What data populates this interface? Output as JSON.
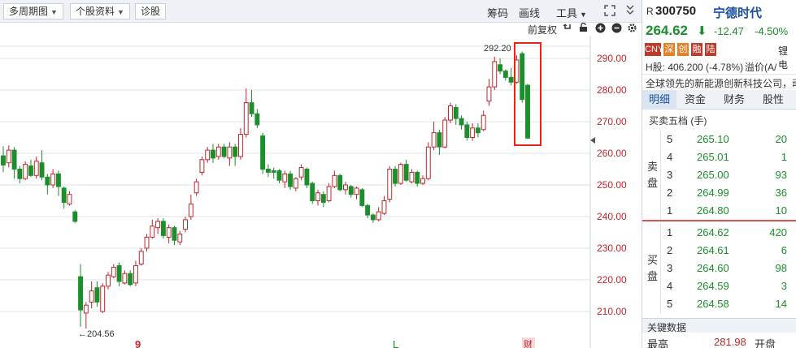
{
  "toolbar": {
    "period_label": "多周期图",
    "stock_info_label": "个股资料",
    "diagnose_label": "诊股",
    "chips_label": "筹码",
    "draw_label": "画线",
    "tools_label": "工具",
    "expand_icon": "expand-icon",
    "collapse_icon": "collapse-icon"
  },
  "subbar": {
    "adjust_label": "前复权",
    "icons": [
      "undo-icon",
      "lock-icon",
      "zoom-in-icon",
      "zoom-out-icon",
      "settings-icon"
    ]
  },
  "chart_data": {
    "type": "candlestick",
    "y_ticks": [
      "290.00",
      "280.00",
      "270.00",
      "260.00",
      "250.00",
      "240.00",
      "230.00",
      "220.00",
      "210.00"
    ],
    "ylim": [
      203,
      295
    ],
    "max_label": "292.20",
    "min_label": "←204.56",
    "bottom_markers": [
      "9",
      "L",
      "财"
    ],
    "candles": [
      {
        "o": 259.2,
        "c": 256.3,
        "h": 262.2,
        "l": 254.0
      },
      {
        "o": 257.0,
        "c": 261.0,
        "h": 262.5,
        "l": 255.5
      },
      {
        "o": 261.0,
        "c": 255.0,
        "h": 262.0,
        "l": 252.0
      },
      {
        "o": 255.0,
        "c": 252.0,
        "h": 256.0,
        "l": 250.5
      },
      {
        "o": 252.0,
        "c": 256.5,
        "h": 257.5,
        "l": 251.5
      },
      {
        "o": 256.0,
        "c": 253.0,
        "h": 258.0,
        "l": 252.5
      },
      {
        "o": 253.0,
        "c": 257.5,
        "h": 259.0,
        "l": 252.0
      },
      {
        "o": 257.0,
        "c": 252.5,
        "h": 261.0,
        "l": 251.5
      },
      {
        "o": 252.5,
        "c": 250.0,
        "h": 253.5,
        "l": 247.0
      },
      {
        "o": 250.0,
        "c": 253.5,
        "h": 255.0,
        "l": 249.0
      },
      {
        "o": 253.5,
        "c": 249.5,
        "h": 254.5,
        "l": 246.5
      },
      {
        "o": 249.0,
        "c": 244.5,
        "h": 249.5,
        "l": 242.5
      },
      {
        "o": 244.0,
        "c": 247.0,
        "h": 248.0,
        "l": 243.5
      },
      {
        "o": 241.5,
        "c": 238.5,
        "h": 242.0,
        "l": 238.0
      },
      {
        "o": 221.0,
        "c": 210.5,
        "h": 225.0,
        "l": 205.2
      },
      {
        "o": 209.5,
        "c": 212.0,
        "h": 213.0,
        "l": 204.6
      },
      {
        "o": 213.0,
        "c": 216.5,
        "h": 219.5,
        "l": 211.0
      },
      {
        "o": 217.5,
        "c": 213.0,
        "h": 219.5,
        "l": 211.5
      },
      {
        "o": 210.0,
        "c": 218.0,
        "h": 219.0,
        "l": 209.5
      },
      {
        "o": 218.0,
        "c": 221.5,
        "h": 222.5,
        "l": 217.0
      },
      {
        "o": 221.0,
        "c": 224.0,
        "h": 225.0,
        "l": 220.5
      },
      {
        "o": 224.5,
        "c": 219.5,
        "h": 225.5,
        "l": 218.0
      },
      {
        "o": 219.0,
        "c": 222.0,
        "h": 223.0,
        "l": 218.5
      },
      {
        "o": 222.0,
        "c": 218.5,
        "h": 223.0,
        "l": 218.0
      },
      {
        "o": 219.0,
        "c": 224.5,
        "h": 226.0,
        "l": 218.0
      },
      {
        "o": 225.0,
        "c": 229.0,
        "h": 230.0,
        "l": 224.5
      },
      {
        "o": 230.0,
        "c": 233.5,
        "h": 234.5,
        "l": 229.0
      },
      {
        "o": 233.5,
        "c": 237.0,
        "h": 239.0,
        "l": 233.0
      },
      {
        "o": 236.5,
        "c": 238.5,
        "h": 239.5,
        "l": 234.5
      },
      {
        "o": 238.5,
        "c": 234.0,
        "h": 239.5,
        "l": 233.0
      },
      {
        "o": 233.5,
        "c": 236.5,
        "h": 237.5,
        "l": 231.5
      },
      {
        "o": 236.5,
        "c": 232.5,
        "h": 237.0,
        "l": 231.0
      },
      {
        "o": 232.0,
        "c": 234.5,
        "h": 235.5,
        "l": 231.0
      },
      {
        "o": 236.0,
        "c": 239.0,
        "h": 240.0,
        "l": 235.0
      },
      {
        "o": 240.0,
        "c": 244.0,
        "h": 247.0,
        "l": 239.0
      },
      {
        "o": 247.5,
        "c": 251.0,
        "h": 252.0,
        "l": 246.5
      },
      {
        "o": 254.0,
        "c": 258.0,
        "h": 259.0,
        "l": 253.0
      },
      {
        "o": 258.0,
        "c": 261.0,
        "h": 262.0,
        "l": 257.0
      },
      {
        "o": 261.0,
        "c": 258.5,
        "h": 263.0,
        "l": 257.0
      },
      {
        "o": 259.0,
        "c": 262.0,
        "h": 263.0,
        "l": 258.0
      },
      {
        "o": 262.0,
        "c": 259.0,
        "h": 263.0,
        "l": 258.5
      },
      {
        "o": 258.5,
        "c": 262.0,
        "h": 263.5,
        "l": 256.0
      },
      {
        "o": 262.0,
        "c": 259.0,
        "h": 263.0,
        "l": 256.0
      },
      {
        "o": 259.0,
        "c": 266.0,
        "h": 268.0,
        "l": 258.0
      },
      {
        "o": 266.0,
        "c": 276.0,
        "h": 280.5,
        "l": 265.0
      },
      {
        "o": 276.0,
        "c": 272.5,
        "h": 280.0,
        "l": 271.5
      },
      {
        "o": 272.5,
        "c": 269.0,
        "h": 274.0,
        "l": 268.0
      },
      {
        "o": 265.5,
        "c": 255.0,
        "h": 266.5,
        "l": 253.5
      },
      {
        "o": 255.0,
        "c": 254.0,
        "h": 256.5,
        "l": 252.5
      },
      {
        "o": 254.5,
        "c": 254.0,
        "h": 255.5,
        "l": 252.0
      },
      {
        "o": 254.5,
        "c": 251.5,
        "h": 255.0,
        "l": 250.5
      },
      {
        "o": 251.0,
        "c": 253.5,
        "h": 254.5,
        "l": 249.0
      },
      {
        "o": 253.5,
        "c": 249.5,
        "h": 254.5,
        "l": 248.5
      },
      {
        "o": 249.0,
        "c": 252.0,
        "h": 252.5,
        "l": 248.0
      },
      {
        "o": 252.5,
        "c": 255.5,
        "h": 256.5,
        "l": 251.5
      },
      {
        "o": 255.0,
        "c": 250.0,
        "h": 255.5,
        "l": 249.0
      },
      {
        "o": 250.5,
        "c": 245.0,
        "h": 251.0,
        "l": 244.0
      },
      {
        "o": 245.0,
        "c": 247.5,
        "h": 248.5,
        "l": 243.5
      },
      {
        "o": 247.0,
        "c": 244.5,
        "h": 248.0,
        "l": 243.0
      },
      {
        "o": 245.0,
        "c": 249.5,
        "h": 250.5,
        "l": 244.5
      },
      {
        "o": 249.5,
        "c": 253.0,
        "h": 254.5,
        "l": 249.0
      },
      {
        "o": 253.0,
        "c": 248.5,
        "h": 253.5,
        "l": 248.0
      },
      {
        "o": 248.5,
        "c": 250.0,
        "h": 251.0,
        "l": 247.0
      },
      {
        "o": 249.5,
        "c": 247.0,
        "h": 250.0,
        "l": 246.0
      },
      {
        "o": 247.0,
        "c": 249.0,
        "h": 249.5,
        "l": 245.5
      },
      {
        "o": 248.5,
        "c": 243.5,
        "h": 249.0,
        "l": 243.0
      },
      {
        "o": 243.5,
        "c": 240.5,
        "h": 244.0,
        "l": 239.5
      },
      {
        "o": 240.5,
        "c": 239.0,
        "h": 241.0,
        "l": 238.0
      },
      {
        "o": 239.0,
        "c": 241.5,
        "h": 243.0,
        "l": 238.5
      },
      {
        "o": 241.0,
        "c": 245.0,
        "h": 246.5,
        "l": 240.5
      },
      {
        "o": 245.5,
        "c": 255.0,
        "h": 256.0,
        "l": 244.5
      },
      {
        "o": 255.0,
        "c": 250.5,
        "h": 256.0,
        "l": 249.5
      },
      {
        "o": 250.5,
        "c": 256.5,
        "h": 257.0,
        "l": 250.0
      },
      {
        "o": 256.5,
        "c": 251.5,
        "h": 258.0,
        "l": 251.0
      },
      {
        "o": 251.0,
        "c": 254.0,
        "h": 255.0,
        "l": 250.5
      },
      {
        "o": 254.0,
        "c": 250.5,
        "h": 254.5,
        "l": 249.5
      },
      {
        "o": 250.5,
        "c": 252.0,
        "h": 253.0,
        "l": 250.0
      },
      {
        "o": 252.0,
        "c": 262.0,
        "h": 263.5,
        "l": 251.5
      },
      {
        "o": 262.0,
        "c": 266.5,
        "h": 270.0,
        "l": 261.0
      },
      {
        "o": 266.5,
        "c": 262.0,
        "h": 267.5,
        "l": 259.5
      },
      {
        "o": 262.0,
        "c": 270.5,
        "h": 271.5,
        "l": 261.5
      },
      {
        "o": 270.5,
        "c": 275.0,
        "h": 276.0,
        "l": 269.5
      },
      {
        "o": 274.5,
        "c": 271.0,
        "h": 275.5,
        "l": 269.0
      },
      {
        "o": 271.0,
        "c": 269.0,
        "h": 272.0,
        "l": 267.5
      },
      {
        "o": 269.0,
        "c": 265.0,
        "h": 270.0,
        "l": 264.0
      },
      {
        "o": 265.0,
        "c": 268.0,
        "h": 269.5,
        "l": 264.0
      },
      {
        "o": 268.0,
        "c": 266.5,
        "h": 269.5,
        "l": 265.0
      },
      {
        "o": 267.5,
        "c": 272.0,
        "h": 273.5,
        "l": 267.0
      },
      {
        "o": 276.5,
        "c": 281.0,
        "h": 283.5,
        "l": 275.0
      },
      {
        "o": 281.0,
        "c": 289.0,
        "h": 290.5,
        "l": 280.0
      },
      {
        "o": 288.0,
        "c": 286.0,
        "h": 290.0,
        "l": 285.0
      },
      {
        "o": 286.0,
        "c": 284.0,
        "h": 286.5,
        "l": 283.0
      },
      {
        "o": 284.0,
        "c": 282.5,
        "h": 287.0,
        "l": 281.5
      },
      {
        "o": 282.5,
        "c": 289.5,
        "h": 291.0,
        "l": 282.0
      },
      {
        "o": 291.5,
        "c": 277.0,
        "h": 292.2,
        "l": 276.0
      },
      {
        "o": 281.5,
        "c": 264.8,
        "h": 282.0,
        "l": 264.6
      }
    ]
  },
  "stock": {
    "r_label": "R",
    "code": "300750",
    "name": "宁德时代",
    "price": "264.62",
    "arrow": "⬇",
    "change": "-12.47",
    "change_pct": "-4.50%",
    "tags": [
      {
        "text": "CNY",
        "color": "#c0392b"
      },
      {
        "text": "深",
        "color": "#e67e22"
      },
      {
        "text": "创",
        "color": "#e67e22"
      },
      {
        "text": "融",
        "color": "#c0392b"
      },
      {
        "text": "陆",
        "color": "#c0392b"
      }
    ],
    "industry": "锂电",
    "h_share": "H股: 406.200 (-4.78%)",
    "premium": "溢价(A/",
    "description": "全球领先的新能源创新科技公司，动"
  },
  "tabs": [
    "明细",
    "资金",
    "财务",
    "股性"
  ],
  "order_book": {
    "title": "买卖五档 (手)",
    "ask_label": "卖盘",
    "bid_label": "买盘",
    "asks": [
      {
        "n": "5",
        "p": "265.10",
        "v": "20"
      },
      {
        "n": "4",
        "p": "265.01",
        "v": "1"
      },
      {
        "n": "3",
        "p": "265.00",
        "v": "93"
      },
      {
        "n": "2",
        "p": "264.99",
        "v": "36"
      },
      {
        "n": "1",
        "p": "264.80",
        "v": "10"
      }
    ],
    "bids": [
      {
        "n": "1",
        "p": "264.62",
        "v": "420"
      },
      {
        "n": "2",
        "p": "264.61",
        "v": "6"
      },
      {
        "n": "3",
        "p": "264.60",
        "v": "98"
      },
      {
        "n": "4",
        "p": "264.59",
        "v": "3"
      },
      {
        "n": "5",
        "p": "264.58",
        "v": "14"
      }
    ]
  },
  "key_data": {
    "title": "关键数据",
    "high_label": "最高",
    "high_value": "281.98",
    "open_label": "开盘"
  }
}
